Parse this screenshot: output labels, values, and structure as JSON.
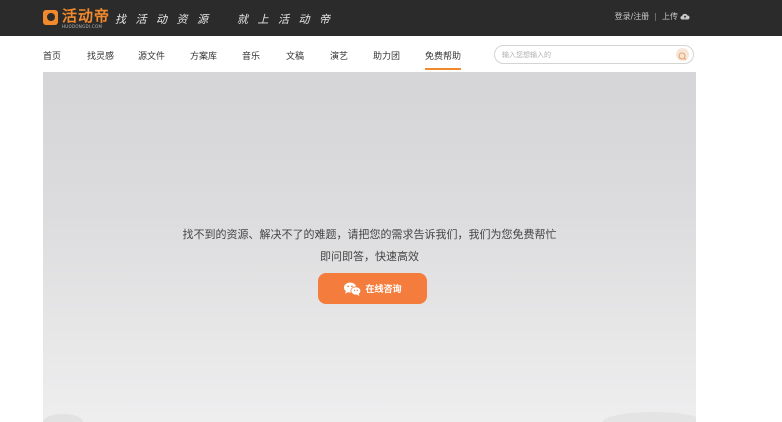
{
  "header": {
    "logo_name": "活动帝",
    "logo_sub": "HUODONGDI.COM",
    "slogan": "找 活 动 资 源    就 上 活 动 帝",
    "login_label": "登录/注册",
    "divider": "|",
    "upload_label": "上传",
    "upload_icon": "cloud-upload-icon"
  },
  "nav": {
    "items": [
      {
        "label": "首页"
      },
      {
        "label": "找灵感"
      },
      {
        "label": "源文件"
      },
      {
        "label": "方案库"
      },
      {
        "label": "音乐"
      },
      {
        "label": "文稿"
      },
      {
        "label": "演艺"
      },
      {
        "label": "助力团"
      },
      {
        "label": "免费帮助"
      }
    ],
    "active_index": 8
  },
  "search": {
    "placeholder": "输入您想输入的",
    "value": "",
    "icon": "search-icon"
  },
  "banner": {
    "line1": "找不到的资源、解决不了的难题，请把您的需求告诉我们，我们为您免费帮忙",
    "line2": "即问即答，快速高效",
    "button_label": "在线咨询",
    "button_icon": "wechat-icon"
  },
  "colors": {
    "accent": "#f47c3c",
    "topbar": "#2b2b2b"
  }
}
